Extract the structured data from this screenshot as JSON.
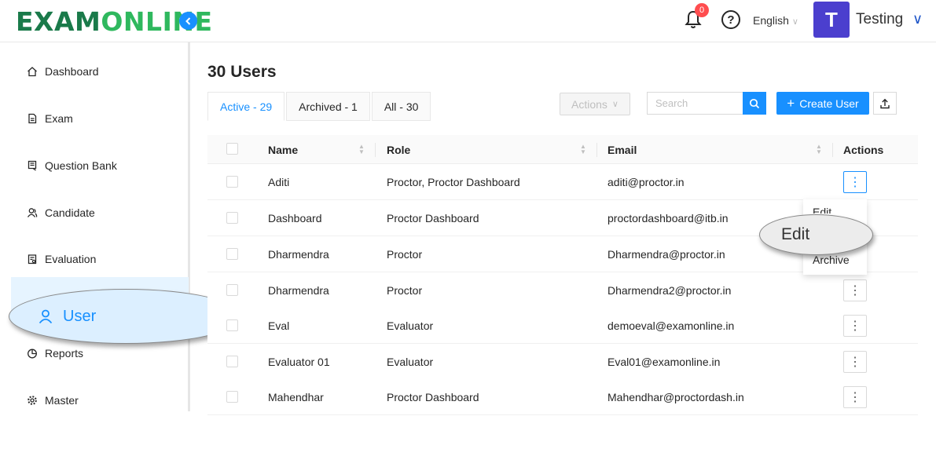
{
  "header": {
    "logo_part1": "EXAM",
    "logo_part2": "ONLINE",
    "notification_count": "0",
    "help_glyph": "?",
    "language": "English",
    "avatar_letter": "T",
    "user_name": "Testing"
  },
  "sidebar": {
    "items": [
      {
        "label": "Dashboard",
        "icon": "home-icon"
      },
      {
        "label": "Exam",
        "icon": "file-icon"
      },
      {
        "label": "Question Bank",
        "icon": "book-icon"
      },
      {
        "label": "Candidate",
        "icon": "users-icon"
      },
      {
        "label": "Evaluation",
        "icon": "clipboard-icon"
      },
      {
        "label": "User",
        "icon": "user-icon",
        "active": true
      },
      {
        "label": "Reports",
        "icon": "pie-chart-icon"
      },
      {
        "label": "Master",
        "icon": "gear-icon"
      }
    ]
  },
  "main": {
    "title": "30 Users",
    "tabs": [
      {
        "label": "Active - 29",
        "active": true
      },
      {
        "label": "Archived - 1"
      },
      {
        "label": "All - 30"
      }
    ],
    "actions_label": "Actions",
    "search_placeholder": "Search",
    "create_label": "Create User"
  },
  "table": {
    "headers": {
      "name": "Name",
      "role": "Role",
      "email": "Email",
      "actions": "Actions"
    },
    "rows": [
      {
        "name": "Aditi",
        "role": "Proctor, Proctor Dashboard",
        "email": "aditi@proctor.in"
      },
      {
        "name": "Dashboard",
        "role": "Proctor Dashboard",
        "email": "proctordashboard@itb.in"
      },
      {
        "name": "Dharmendra",
        "role": "Proctor",
        "email": "Dharmendra@proctor.in"
      },
      {
        "name": "Dharmendra",
        "role": "Proctor",
        "email": "Dharmendra2@proctor.in"
      },
      {
        "name": "Eval",
        "role": "Evaluator",
        "email": "demoeval@examonline.in"
      },
      {
        "name": "Evaluator 01",
        "role": "Evaluator",
        "email": "Eval01@examonline.in"
      },
      {
        "name": "Mahendhar",
        "role": "Proctor Dashboard",
        "email": "Mahendhar@proctordash.in"
      }
    ]
  },
  "dropdown": {
    "items": [
      "Edit",
      "Archive"
    ],
    "callout": "Edit"
  },
  "colors": {
    "primary": "#1890ff",
    "avatar": "#4b3fce",
    "logo_dark": "#1a7a4a",
    "logo_light": "#2fb85e",
    "badge": "#ff4d4f"
  }
}
